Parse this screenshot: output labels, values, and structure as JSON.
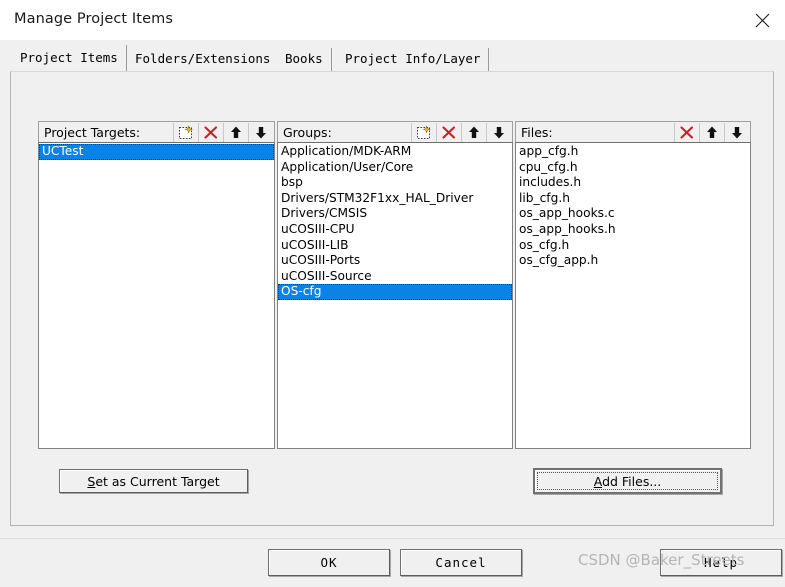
{
  "window": {
    "title": "Manage Project Items",
    "close_icon": "close-icon"
  },
  "tabs": [
    {
      "label": "Project Items",
      "active": true
    },
    {
      "label": "Folders/Extensions",
      "active": false
    },
    {
      "label": "Books",
      "active": false
    },
    {
      "label": "Project Info/Layer",
      "active": false
    }
  ],
  "panels": {
    "targets": {
      "header": "Project Targets:",
      "tools": [
        "new-item-icon",
        "delete-icon",
        "move-up-icon",
        "move-down-icon"
      ],
      "items": [
        {
          "label": "UCTest",
          "selected": true
        }
      ]
    },
    "groups": {
      "header": "Groups:",
      "tools": [
        "new-item-icon",
        "delete-icon",
        "move-up-icon",
        "move-down-icon"
      ],
      "items": [
        {
          "label": "Application/MDK-ARM",
          "selected": false
        },
        {
          "label": "Application/User/Core",
          "selected": false
        },
        {
          "label": "bsp",
          "selected": false
        },
        {
          "label": "Drivers/STM32F1xx_HAL_Driver",
          "selected": false
        },
        {
          "label": "Drivers/CMSIS",
          "selected": false
        },
        {
          "label": "uCOSIII-CPU",
          "selected": false
        },
        {
          "label": "uCOSIII-LIB",
          "selected": false
        },
        {
          "label": "uCOSIII-Ports",
          "selected": false
        },
        {
          "label": "uCOSIII-Source",
          "selected": false
        },
        {
          "label": "OS-cfg",
          "selected": true
        }
      ]
    },
    "files": {
      "header": "Files:",
      "tools": [
        "delete-icon",
        "move-up-icon",
        "move-down-icon"
      ],
      "items": [
        {
          "label": "app_cfg.h",
          "selected": false
        },
        {
          "label": "cpu_cfg.h",
          "selected": false
        },
        {
          "label": "includes.h",
          "selected": false
        },
        {
          "label": "lib_cfg.h",
          "selected": false
        },
        {
          "label": "os_app_hooks.c",
          "selected": false
        },
        {
          "label": "os_app_hooks.h",
          "selected": false
        },
        {
          "label": "os_cfg.h",
          "selected": false
        },
        {
          "label": "os_cfg_app.h",
          "selected": false
        }
      ]
    }
  },
  "buttons": {
    "set_current_target": {
      "accel": "S",
      "rest": "et as Current Target"
    },
    "add_files": {
      "accel": "A",
      "rest": "dd Files..."
    },
    "ok": "OK",
    "cancel": "Cancel",
    "help": "Help"
  },
  "watermark": "CSDN @Baker_Streets",
  "colors": {
    "selection": "#0a82e6",
    "delete_icon": "#c0252c",
    "dialog_bg": "#f0f0f0",
    "listbox_bg": "#ffffff"
  }
}
